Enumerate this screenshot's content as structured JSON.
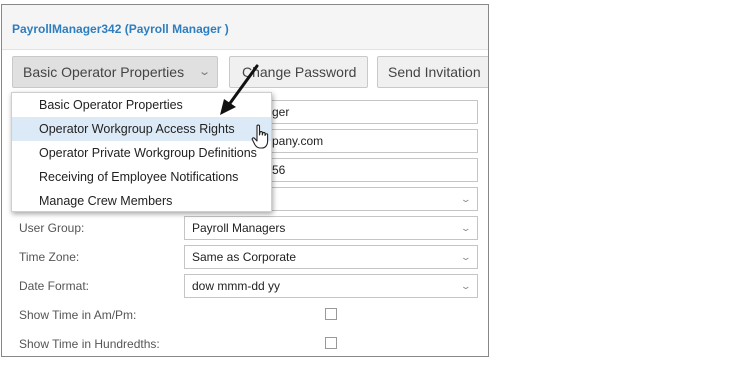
{
  "header": {
    "title": "PayrollManager342 (Payroll Manager )"
  },
  "toolbar": {
    "dropdown_label": "Basic Operator Properties",
    "change_password_label": "Change Password",
    "send_invitation_label": "Send Invitation"
  },
  "dropdown_menu": {
    "items": [
      {
        "label": "Basic Operator Properties"
      },
      {
        "label": "Operator Workgroup Access Rights"
      },
      {
        "label": "Operator Private Workgroup Definitions"
      },
      {
        "label": "Receiving of Employee Notifications"
      },
      {
        "label": "Manage Crew Members"
      }
    ],
    "hovered_index": 1
  },
  "form": {
    "partial_fields": [
      "ger",
      "pany.com",
      "56"
    ],
    "user_group": {
      "label": "User Group:",
      "value": "Payroll Managers"
    },
    "time_zone": {
      "label": "Time Zone:",
      "value": "Same as Corporate"
    },
    "date_format": {
      "label": "Date Format:",
      "value": "dow mmm-dd yy"
    },
    "show_ampm": {
      "label": "Show Time in Am/Pm:",
      "checked": false
    },
    "show_hundredths": {
      "label": "Show Time in Hundredths:",
      "checked": false
    }
  },
  "colors": {
    "title": "#2e7ebf",
    "menu_hover": "#dce9f6"
  },
  "icons": [
    "chevron-down-icon",
    "arrow-annotation-icon",
    "hand-cursor-icon"
  ]
}
